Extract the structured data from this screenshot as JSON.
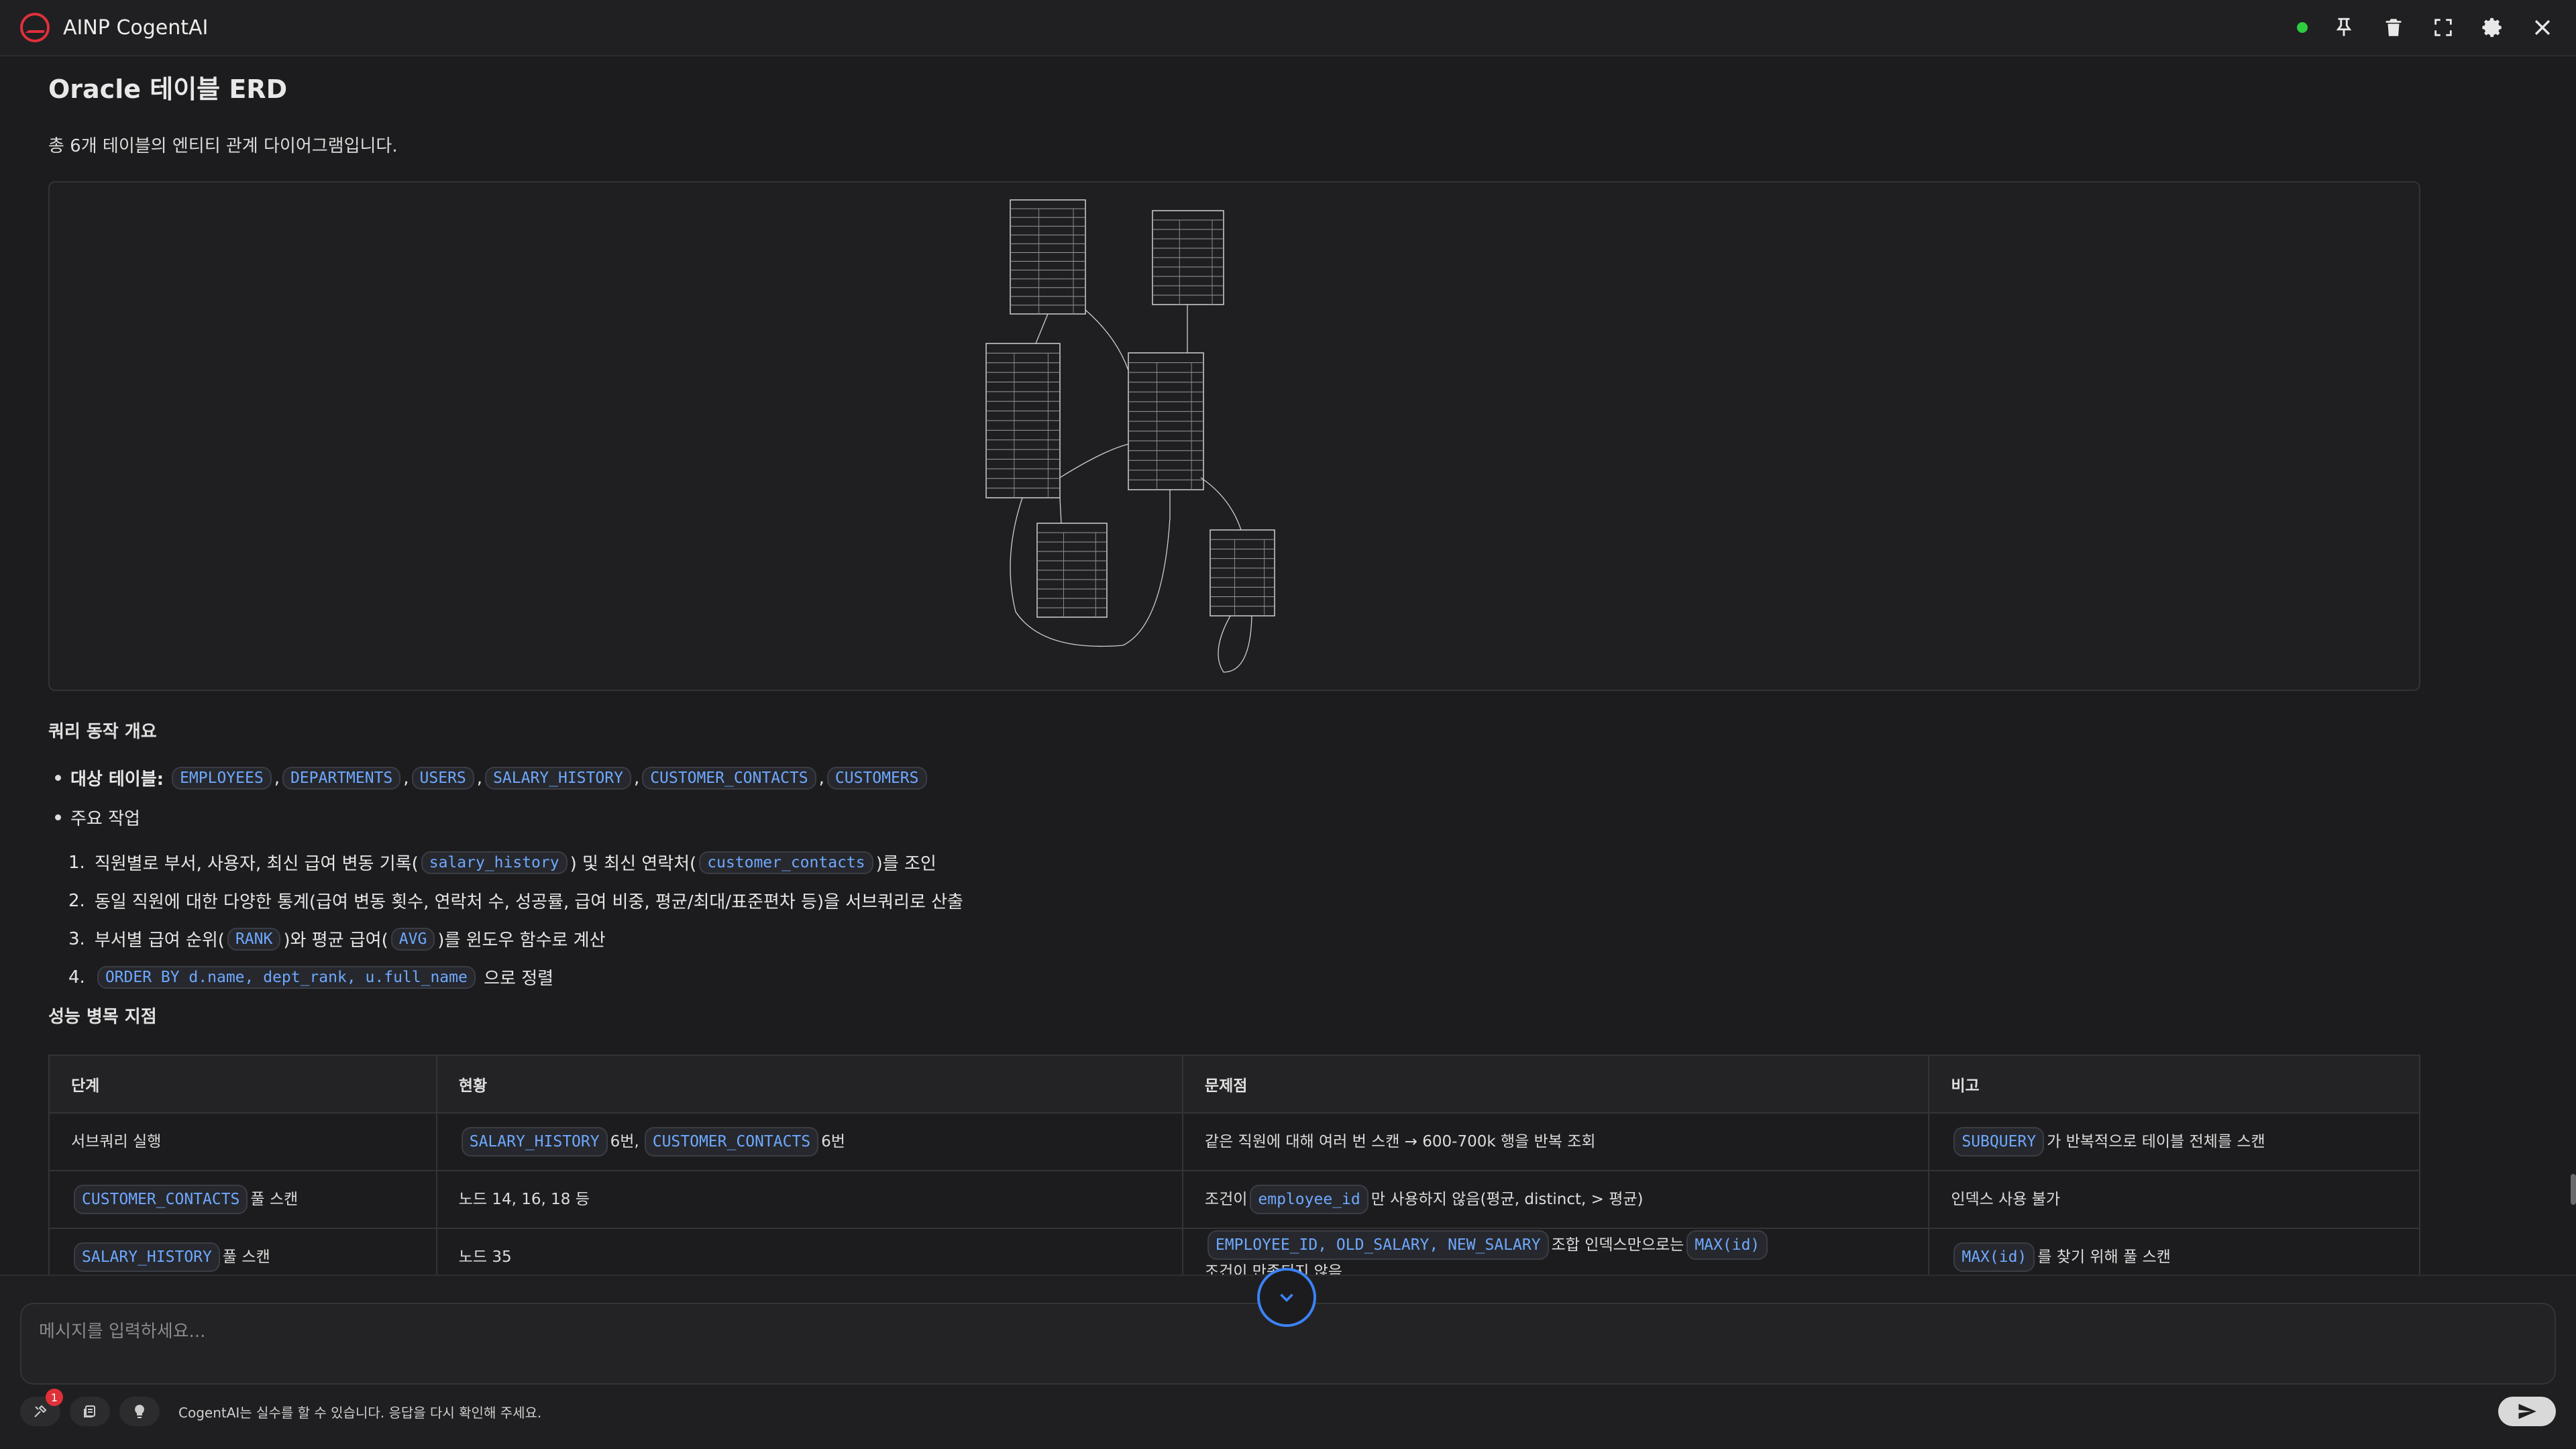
{
  "app": {
    "title": "AINP CogentAI"
  },
  "page": {
    "title": "Oracle 테이블 ERD",
    "subtitle": "총 6개 테이블의 엔티티 관계 다이어그램입니다."
  },
  "overview": {
    "heading": "쿼리 동작 개요",
    "tables_label": "대상 테이블:",
    "tables": [
      "EMPLOYEES",
      "DEPARTMENTS",
      "USERS",
      "SALARY_HISTORY",
      "CUSTOMER_CONTACTS",
      "CUSTOMERS"
    ],
    "main_work_label": "주요 작업",
    "steps": [
      {
        "num": "1.",
        "before": "직원별로 부서, 사용자, 최신 급여 변동 기록(",
        "code": "salary_history",
        "middle": ") 및 최신 연락처(",
        "code2": "customer_contacts",
        "after": ")를 조인"
      },
      {
        "num": "2.",
        "text": "동일 직원에 대한 다양한 통계(급여 변동 횟수, 연락처 수, 성공률, 급여 비중, 평균/최대/표준편차 등)을 서브쿼리로 산출"
      },
      {
        "num": "3.",
        "before": "부서별 급여 순위(",
        "code": "RANK",
        "middle": ")와 평균 급여(",
        "code2": "AVG",
        "after": ")를 윈도우 함수로 계산"
      },
      {
        "num": "4.",
        "code": "ORDER BY d.name, dept_rank, u.full_name",
        "after": " 으로 정렬"
      }
    ]
  },
  "bottleneck": {
    "heading": "성능 병목 지점",
    "columns": [
      "단계",
      "현황",
      "문제점",
      "비고"
    ],
    "rows": [
      {
        "stage_text": "서브쿼리 실행",
        "status_code1": "SALARY_HISTORY",
        "status_text1": "6번,",
        "status_code2": "CUSTOMER_CONTACTS",
        "status_text2": "6번",
        "issue_text": "같은 직원에 대해 여러 번 스캔 → 600-700k 행을 반복 조회",
        "note_code": "SUBQUERY",
        "note_text": "가 반복적으로 테이블 전체를 스캔"
      },
      {
        "stage_code": "CUSTOMER_CONTACTS",
        "stage_text": "풀 스캔",
        "status_text1": "노드 14, 16, 18 등",
        "issue_pre": "조건이",
        "issue_code": "employee_id",
        "issue_text": "만 사용하지 않음(평균, distinct, > 평균)",
        "note_text": "인덱스 사용 불가"
      },
      {
        "stage_code": "SALARY_HISTORY",
        "stage_text": "풀 스캔",
        "status_text1": "노드 35",
        "issue_code": "EMPLOYEE_ID, OLD_SALARY, NEW_SALARY",
        "issue_text": "조합 인덱스만으로는",
        "issue_code2": "MAX(id)",
        "issue_text2": "조건이 만족되지 않음",
        "note_code": "MAX(id)",
        "note_text": "를 찾기 위해 풀 스캔"
      }
    ]
  },
  "composer": {
    "placeholder": "메시지를 입력하세요...",
    "disclaimer": "CogentAI는 실수를 할 수 있습니다. 응답을 다시 확인해 주세요.",
    "tools_badge": "1"
  },
  "icons": {
    "logo": "ainp-logo-icon",
    "pin": "pin-icon",
    "trash": "trash-icon",
    "fullscreen": "fullscreen-icon",
    "settings": "gear-icon",
    "close": "close-icon",
    "scroll_down": "chevron-down-icon",
    "send": "send-icon"
  },
  "colors": {
    "accent": "#3b82f6",
    "code_text": "#6fa8ff",
    "status_online": "#2ecc40",
    "brand": "#e0303a"
  }
}
